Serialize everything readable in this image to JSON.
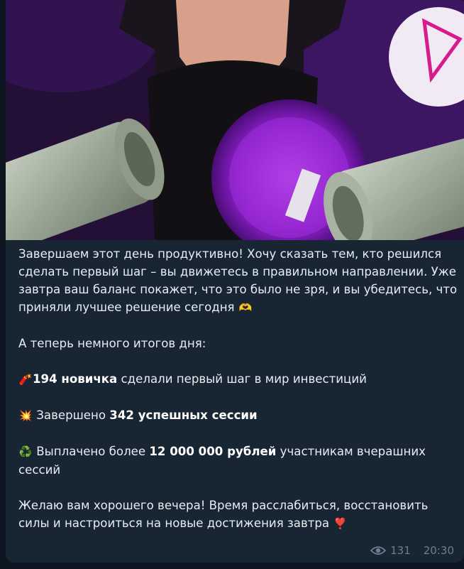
{
  "message": {
    "p1": "Завершаем этот день продуктивно! Хочу сказать тем, кто решился сделать первый шаг – вы движетесь в правильном направлении. Уже завтра ваш баланс покажет, что это было не зря, и вы убедитесь, что приняли лучшее решение сегодня",
    "p1_emoji": "🫶",
    "p2": "А теперь немного итогов дня:",
    "line1_emoji": "🧨",
    "line1_bold": "194 новичка",
    "line1_rest": " сделали первый шаг в мир инвестиций",
    "line2_emoji": "💥",
    "line2_pre": "Завершено ",
    "line2_bold": "342 успешных сессии",
    "line3_emoji": "♻️",
    "line3_pre": "Выплачено более ",
    "line3_bold": "12 000 000 рублей",
    "line3_rest": " участникам вчерашних сессий",
    "p_last": "Желаю вам хорошего вечера! Время расслабиться, восстановить силы и настроиться на новые достижения завтра",
    "p_last_emoji": "❣️"
  },
  "meta": {
    "views": "131",
    "time": "20:30"
  },
  "colors": {
    "background": "#0e1621",
    "bubble": "#182533",
    "accent_purple": "#b84de8"
  }
}
